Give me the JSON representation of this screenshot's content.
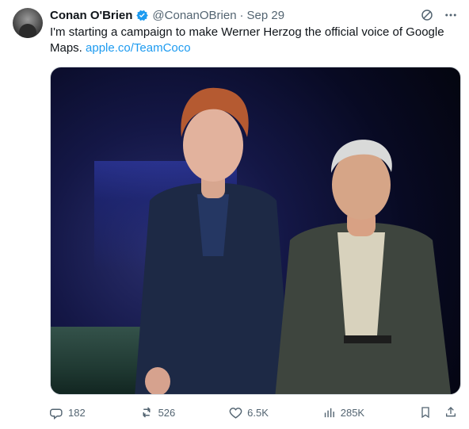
{
  "author": {
    "name": "Conan O'Brien",
    "handle": "@ConanOBrien",
    "separator": "·",
    "date": "Sep 29",
    "avatar_icon": "profile-avatar-icon",
    "verified_icon": "verified-badge-icon"
  },
  "tweet": {
    "text": "I'm starting a campaign to make Werner Herzog the official voice of Google Maps.",
    "link_text": "apple.co/TeamCoco"
  },
  "media": {
    "type": "photo"
  },
  "actions": {
    "reply": {
      "count": "182",
      "icon": "reply-icon"
    },
    "retweet": {
      "count": "526",
      "icon": "retweet-icon"
    },
    "like": {
      "count": "6.5K",
      "icon": "heart-icon"
    },
    "views": {
      "count": "285K",
      "icon": "analytics-icon"
    },
    "bookmark": {
      "icon": "bookmark-icon"
    },
    "share": {
      "icon": "share-icon"
    }
  },
  "colors": {
    "link": "#1d9bf0",
    "muted": "#536471",
    "text": "#0f1419",
    "verified": "#1d9bf0"
  }
}
